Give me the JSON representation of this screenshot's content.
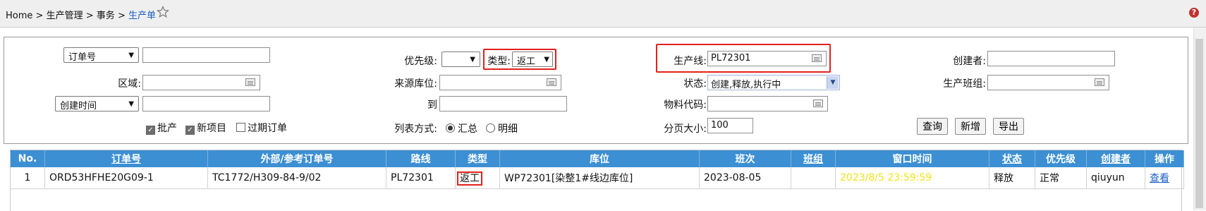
{
  "breadcrumb": {
    "home": "Home",
    "sep": ">",
    "level1": "生产管理",
    "level2": "事务",
    "current": "生产单"
  },
  "icons": {
    "favorite": "star-outline-icon",
    "help": "help-icon"
  },
  "search": {
    "order_field_select": "订单号",
    "order_value": "",
    "region_label": "区域:",
    "region_value": "",
    "date_field_select": "创建时间",
    "date_value": "",
    "checkbox_batch": {
      "label": "批产",
      "checked": true
    },
    "checkbox_new": {
      "label": "新项目",
      "checked": true
    },
    "checkbox_overdue": {
      "label": "过期订单",
      "checked": false
    },
    "priority_label": "优先级:",
    "priority_value": "",
    "type_label": "类型:",
    "type_value": "返工",
    "source_loc_label": "来源库位:",
    "source_loc_value": "",
    "to_label": "到",
    "to_value": "",
    "list_mode_label": "列表方式:",
    "list_mode_summary": "汇总",
    "list_mode_detail": "明细",
    "list_mode_selected": "汇总",
    "line_label": "生产线:",
    "line_value": "PL72301",
    "status_label": "状态:",
    "status_value": "创建,释放,执行中",
    "material_label": "物料代码:",
    "material_value": "",
    "page_size_label": "分页大小:",
    "page_size_value": "100",
    "creator_label": "创建者:",
    "creator_value": "",
    "team_label": "生产班组:",
    "team_value": "",
    "buttons": {
      "query": "查询",
      "add": "新增",
      "export": "导出"
    }
  },
  "table": {
    "headers": [
      "No.",
      "订单号",
      "外部/参考订单号",
      "路线",
      "类型",
      "库位",
      "班次",
      "班组",
      "窗口时间",
      "状态",
      "优先级",
      "创建者",
      "操作"
    ],
    "rows": [
      {
        "no": "1",
        "order_no": "ORD53HFHE20G09-1",
        "ext_ref": "TC1772/H309-84-9/02",
        "route": "PL72301",
        "type": "返工",
        "location": "WP72301[染整1#线边库位]",
        "shift": "2023-08-05",
        "team": "",
        "window_time": "2023/8/5 23:59:59",
        "status": "释放",
        "priority": "正常",
        "creator": "qiuyun",
        "action": "查看"
      }
    ]
  },
  "colors": {
    "header_bg": "#3c8fd3",
    "highlight_box": "#e3211c",
    "window_time_text": "#f5e218",
    "link": "#1e5fc6"
  }
}
